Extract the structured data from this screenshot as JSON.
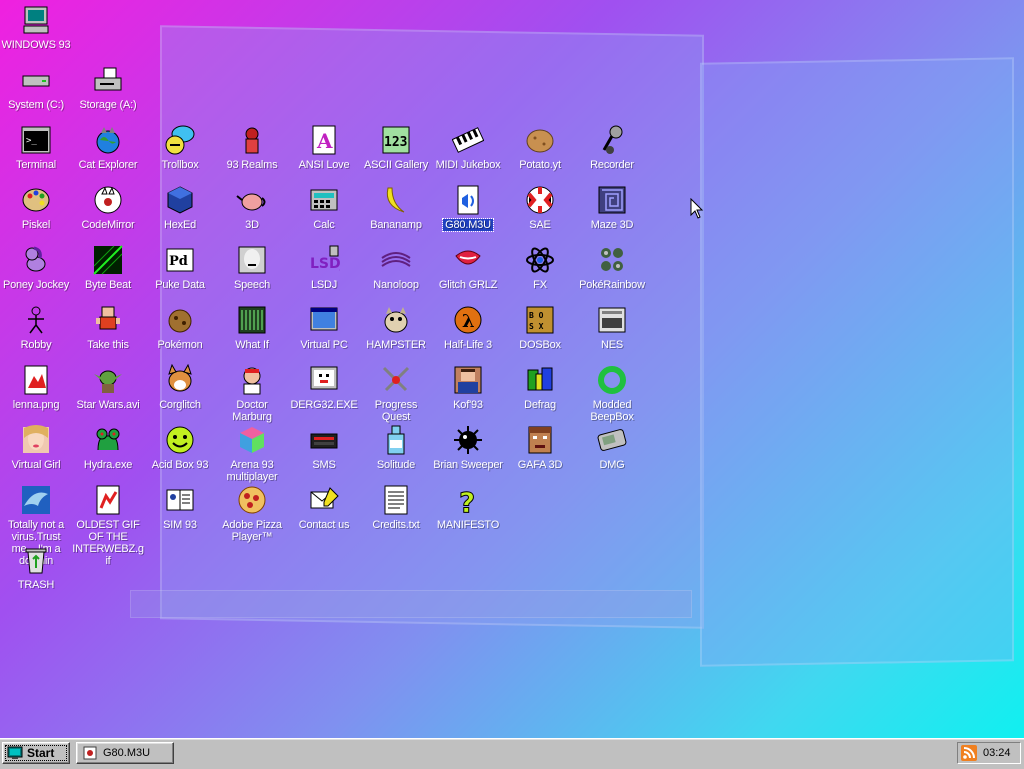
{
  "desktop": {
    "background_colors": [
      "#f020e0",
      "#a050f0",
      "#40d8f0"
    ],
    "icons": [
      {
        "label": "WINDOWS 93",
        "icon": "computer-icon"
      },
      {
        "label": "System (C:)",
        "icon": "drive-icon"
      },
      {
        "label": "Storage (A:)",
        "icon": "storage-drive-icon"
      },
      {
        "label": "Terminal",
        "icon": "terminal-icon"
      },
      {
        "label": "Cat Explorer",
        "icon": "cat-globe-icon"
      },
      {
        "label": "Trollbox",
        "icon": "chat-bubble-icon"
      },
      {
        "label": "93 Realms",
        "icon": "realms-icon"
      },
      {
        "label": "ANSI Love",
        "icon": "ansi-letter-icon"
      },
      {
        "label": "ASCII Gallery",
        "icon": "ascii-numbers-icon"
      },
      {
        "label": "MIDI Jukebox",
        "icon": "piano-icon"
      },
      {
        "label": "Potato.yt",
        "icon": "potato-icon"
      },
      {
        "label": "Recorder",
        "icon": "microphone-icon"
      },
      {
        "label": "Piskel",
        "icon": "palette-icon"
      },
      {
        "label": "CodeMirror",
        "icon": "codemirror-icon"
      },
      {
        "label": "HexEd",
        "icon": "cube-icon"
      },
      {
        "label": "3D",
        "icon": "teapot-icon"
      },
      {
        "label": "Calc",
        "icon": "calculator-icon"
      },
      {
        "label": "Bananamp",
        "icon": "banana-icon"
      },
      {
        "label": "G80.M3U",
        "icon": "playlist-file-icon",
        "selected": true
      },
      {
        "label": "SAE",
        "icon": "ball-icon"
      },
      {
        "label": "Maze 3D",
        "icon": "maze-icon"
      },
      {
        "label": "Poney Jockey",
        "icon": "pony-icon"
      },
      {
        "label": "Byte Beat",
        "icon": "bytebeat-icon"
      },
      {
        "label": "Puke Data",
        "icon": "pd-icon"
      },
      {
        "label": "Speech",
        "icon": "speech-face-icon"
      },
      {
        "label": "LSDJ",
        "icon": "lsdj-icon"
      },
      {
        "label": "Nanoloop",
        "icon": "nanoloop-icon"
      },
      {
        "label": "Glitch GRLZ",
        "icon": "lips-icon"
      },
      {
        "label": "FX",
        "icon": "atom-icon"
      },
      {
        "label": "PokéRainbow",
        "icon": "pokerainbow-icon"
      },
      {
        "label": "Robby",
        "icon": "stick-figure-icon"
      },
      {
        "label": "Take this",
        "icon": "pixel-character-icon"
      },
      {
        "label": "Pokémon",
        "icon": "cookie-creature-icon"
      },
      {
        "label": "What If",
        "icon": "whatif-icon"
      },
      {
        "label": "Virtual PC",
        "icon": "virtual-pc-icon"
      },
      {
        "label": "HAMPSTER",
        "icon": "hamster-icon"
      },
      {
        "label": "Half-Life 3",
        "icon": "half-life-icon"
      },
      {
        "label": "DOSBox",
        "icon": "dosbox-icon"
      },
      {
        "label": "NES",
        "icon": "nes-icon"
      },
      {
        "label": "lenna.png",
        "icon": "image-file-icon"
      },
      {
        "label": "Star Wars.avi",
        "icon": "yoda-icon"
      },
      {
        "label": "Corglitch",
        "icon": "corgi-icon"
      },
      {
        "label": "Doctor Marburg",
        "icon": "doctor-icon"
      },
      {
        "label": "DERG32.EXE",
        "icon": "monitor-face-icon"
      },
      {
        "label": "Progress Quest",
        "icon": "swords-icon"
      },
      {
        "label": "Kof'93",
        "icon": "fighter-icon"
      },
      {
        "label": "Defrag",
        "icon": "defrag-icon"
      },
      {
        "label": "Modded BeepBox",
        "icon": "ring-icon"
      },
      {
        "label": "Virtual Girl",
        "icon": "girl-face-icon"
      },
      {
        "label": "Hydra.exe",
        "icon": "hydra-icon"
      },
      {
        "label": "Acid Box 93",
        "icon": "smiley-icon"
      },
      {
        "label": "Arena 93 multiplayer",
        "icon": "color-cube-icon"
      },
      {
        "label": "SMS",
        "icon": "console-icon"
      },
      {
        "label": "Solitude",
        "icon": "bottle-icon"
      },
      {
        "label": "Brian Sweeper",
        "icon": "mine-icon"
      },
      {
        "label": "GAFA 3D",
        "icon": "doomguy-icon"
      },
      {
        "label": "DMG",
        "icon": "gameboy-icon"
      },
      {
        "label": "Totally not a virus.Trust me... I'm a dolphin",
        "icon": "dolphin-icon"
      },
      {
        "label": "OLDEST GIF OF THE INTERWEBZ.gif",
        "icon": "gif-file-icon"
      },
      {
        "label": "SIM 93",
        "icon": "book-icon"
      },
      {
        "label": "Adobe Pizza Player™",
        "icon": "pizza-icon"
      },
      {
        "label": "Contact us",
        "icon": "letter-pen-icon"
      },
      {
        "label": "Credits.txt",
        "icon": "text-file-icon"
      },
      {
        "label": "MANIFESTO",
        "icon": "question-mark-icon"
      },
      {
        "label": "TRASH",
        "icon": "recycle-bin-icon"
      }
    ]
  },
  "taskbar": {
    "start_label": "Start",
    "task_label": "G80.M3U",
    "clock": "03:24"
  }
}
